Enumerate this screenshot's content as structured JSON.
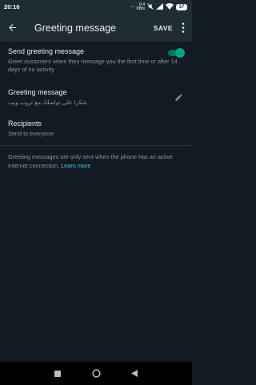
{
  "status_bar": {
    "time": "20:16",
    "icons": [
      "dots-icon",
      "silent-icon",
      "signal-icon",
      "wifi-icon"
    ],
    "speed_value": "0.4",
    "speed_unit": "KB/s",
    "battery": "37"
  },
  "app_bar": {
    "back_icon": "arrow-left-icon",
    "title": "Greeting message",
    "save_label": "SAVE",
    "more_icon": "more-vertical-icon"
  },
  "send_greeting": {
    "title": "Send greeting message",
    "description": "Greet customers when they message you the first time or after 14 days of no activity",
    "enabled": true
  },
  "greeting_message": {
    "title": "Greeting message",
    "value": "شكرا على تواصلك مع تروب ويب",
    "edit_icon": "pencil-icon"
  },
  "recipients": {
    "title": "Recipients",
    "value": "Send to everyone"
  },
  "note": {
    "text": "Greeting messages are only sent when the phone has an active Internet connection. ",
    "link": "Learn more"
  },
  "nav_bar": {
    "icons": [
      "recents-icon",
      "home-icon",
      "back-icon"
    ]
  },
  "colors": {
    "background": "#121b22",
    "app_bar": "#1f2c34",
    "accent": "#00a884",
    "link": "#53bdeb",
    "secondary_text": "#8696a0"
  }
}
